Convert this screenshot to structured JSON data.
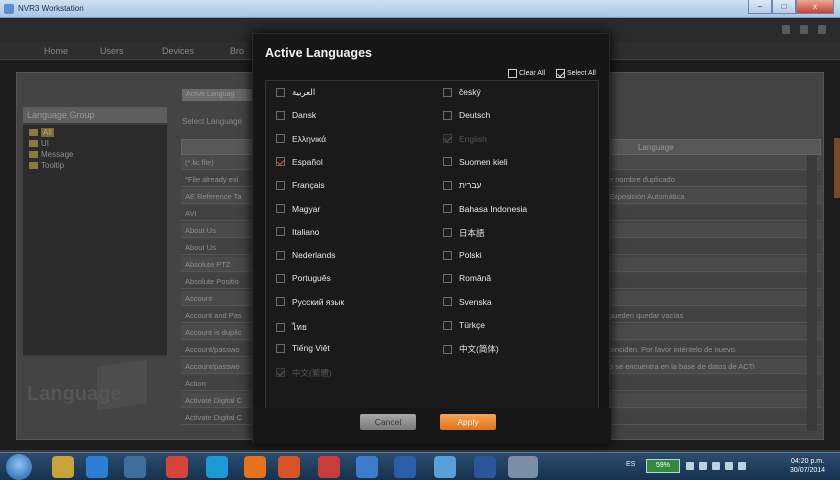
{
  "window": {
    "title": "NVR3 Workstation",
    "min": "–",
    "max": "□",
    "close": "x"
  },
  "nav": {
    "items": [
      "Home",
      "Users",
      "Devices",
      "Bro"
    ]
  },
  "language_group": {
    "title": "Language Group",
    "tree": [
      "All",
      "UI",
      "Message",
      "Tooltip"
    ],
    "watermark": "Language"
  },
  "main": {
    "active_languages_button": "Active Languag",
    "select_language_label": "Select Language",
    "language_column": "Language",
    "rows": [
      {
        "key": "(*.lic file)",
        "value": ""
      },
      {
        "key": "*File already exi",
        "value": "e nombre duplicado"
      },
      {
        "key": "AE Reference Ta",
        "value": "Exposición Automática"
      },
      {
        "key": "AVI",
        "value": ""
      },
      {
        "key": "About Us",
        "value": ""
      },
      {
        "key": "About Us",
        "value": ""
      },
      {
        "key": "Absolute PTZ",
        "value": ""
      },
      {
        "key": "Absolute Positio",
        "value": ""
      },
      {
        "key": "Account",
        "value": ""
      },
      {
        "key": "Account and Pas",
        "value": "pueden quedar vacías"
      },
      {
        "key": "Account is duplic",
        "value": ""
      },
      {
        "key": "Account/passwo",
        "value": "oinciden. Por favor inténtelo de nuevo."
      },
      {
        "key": "Account/passwo",
        "value": "o se encuentra en la base de datos de ACTi"
      },
      {
        "key": "Action",
        "value": ""
      },
      {
        "key": "Activate Digital C",
        "value": ""
      },
      {
        "key": "Activate Digital C",
        "value": ""
      }
    ]
  },
  "modal": {
    "title": "Active Languages",
    "clear_all": "Clear All",
    "select_all": "Select All",
    "cancel": "Cancel",
    "apply": "Apply",
    "languages": [
      {
        "label": "العربية",
        "checked": false,
        "disabled": false
      },
      {
        "label": "český",
        "checked": false,
        "disabled": false
      },
      {
        "label": "Dansk",
        "checked": false,
        "disabled": false
      },
      {
        "label": "Deutsch",
        "checked": false,
        "disabled": false
      },
      {
        "label": "Ελληνικά",
        "checked": false,
        "disabled": false
      },
      {
        "label": "English",
        "checked": true,
        "disabled": true
      },
      {
        "label": "Español",
        "checked": true,
        "disabled": false
      },
      {
        "label": "Suomen kieli",
        "checked": false,
        "disabled": false
      },
      {
        "label": "Français",
        "checked": false,
        "disabled": false
      },
      {
        "label": "עברית",
        "checked": false,
        "disabled": false
      },
      {
        "label": "Magyar",
        "checked": false,
        "disabled": false
      },
      {
        "label": "Bahasa Indonesia",
        "checked": false,
        "disabled": false
      },
      {
        "label": "Italiano",
        "checked": false,
        "disabled": false
      },
      {
        "label": "日本語",
        "checked": false,
        "disabled": false
      },
      {
        "label": "Nederlands",
        "checked": false,
        "disabled": false
      },
      {
        "label": "Polski",
        "checked": false,
        "disabled": false
      },
      {
        "label": "Português",
        "checked": false,
        "disabled": false
      },
      {
        "label": "Română",
        "checked": false,
        "disabled": false
      },
      {
        "label": "Русский язык",
        "checked": false,
        "disabled": false
      },
      {
        "label": "Svenska",
        "checked": false,
        "disabled": false
      },
      {
        "label": "ไทย",
        "checked": false,
        "disabled": false
      },
      {
        "label": "Türkçe",
        "checked": false,
        "disabled": false
      },
      {
        "label": "Tiếng Việt",
        "checked": false,
        "disabled": false
      },
      {
        "label": "中文(简体)",
        "checked": false,
        "disabled": false
      },
      {
        "label": "中文(繁體)",
        "checked": true,
        "disabled": true
      }
    ]
  },
  "taskbar": {
    "language": "ES",
    "battery": "59%",
    "time": "04:20 p.m.",
    "date": "30/07/2014"
  },
  "colors": {
    "accent": "#e07419",
    "check": "#e2554a"
  }
}
